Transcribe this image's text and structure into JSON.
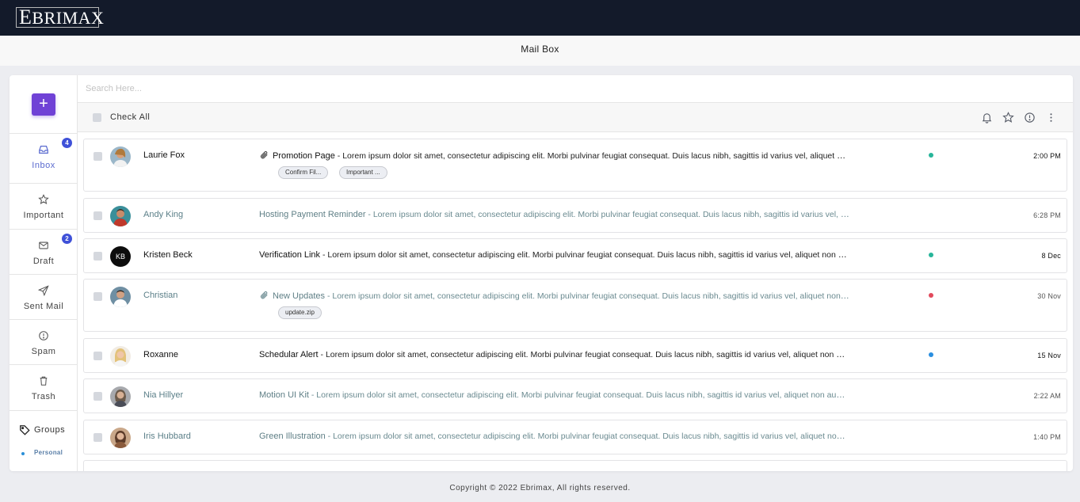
{
  "brand": {
    "logo_initial": "E",
    "logo_rest": "BRIMAX"
  },
  "page": {
    "title": "Mail Box"
  },
  "compose": {
    "label": "+"
  },
  "sidebar": {
    "items": [
      {
        "label": "Inbox",
        "icon": "inbox-icon",
        "badge": "4",
        "active": true
      },
      {
        "label": "Important",
        "icon": "star-icon",
        "badge": null
      },
      {
        "label": "Draft",
        "icon": "mail-icon",
        "badge": "2"
      },
      {
        "label": "Sent Mail",
        "icon": "send-icon",
        "badge": null
      },
      {
        "label": "Spam",
        "icon": "alert-icon",
        "badge": null
      },
      {
        "label": "Trash",
        "icon": "trash-icon",
        "badge": null
      }
    ],
    "groups": {
      "label": "Groups",
      "items": [
        "Personal"
      ]
    }
  },
  "search": {
    "placeholder": "Search Here..."
  },
  "toolbar": {
    "check_all": "Check All"
  },
  "mails": [
    {
      "name": "Laurie Fox",
      "title": "Promotion Page",
      "desc": " - Lorem ipsum dolor sit amet, consectetur adipiscing elit. Morbi pulvinar feugiat consequat. Duis lacus nibh, sagittis id varius vel, aliquet non augue.",
      "time": "2:00 PM",
      "attachments": [
        "Confirm Fil...",
        "Important ..."
      ],
      "status_color": "#27b59a",
      "unread": true
    },
    {
      "name": "Andy King",
      "title": "Hosting Payment Reminder",
      "desc": " - Lorem ipsum dolor sit amet, consectetur adipiscing elit. Morbi pulvinar feugiat consequat. Duis lacus nibh, sagittis id varius vel, aliquet non augue.",
      "time": "6:28 PM",
      "attachments": [],
      "status_color": null,
      "unread": false
    },
    {
      "name": "Kristen Beck",
      "initials": "KB",
      "title": "Verification Link",
      "desc": " - Lorem ipsum dolor sit amet, consectetur adipiscing elit. Morbi pulvinar feugiat consequat. Duis lacus nibh, sagittis id varius vel, aliquet non augue.",
      "time": "8 Dec",
      "attachments": [],
      "status_color": "#27b59a",
      "unread": true
    },
    {
      "name": "Christian",
      "title": "New Updates",
      "desc": " - Lorem ipsum dolor sit amet, consectetur adipiscing elit. Morbi pulvinar feugiat consequat. Duis lacus nibh, sagittis id varius vel, aliquet non augue.",
      "time": "30 Nov",
      "attachments": [
        "update.zip"
      ],
      "status_color": "#e24a5c",
      "unread": false
    },
    {
      "name": "Roxanne",
      "title": "Schedular Alert",
      "desc": " - Lorem ipsum dolor sit amet, consectetur adipiscing elit. Morbi pulvinar feugiat consequat. Duis lacus nibh, sagittis id varius vel, aliquet non augue.",
      "time": "15 Nov",
      "attachments": [],
      "status_color": "#2a8fe0",
      "unread": true
    },
    {
      "name": "Nia Hillyer",
      "title": "Motion UI Kit",
      "desc": " - Lorem ipsum dolor sit amet, consectetur adipiscing elit. Morbi pulvinar feugiat consequat. Duis lacus nibh, sagittis id varius vel, aliquet non augue.",
      "time": "2:22 AM",
      "attachments": [],
      "status_color": null,
      "unread": false
    },
    {
      "name": "Iris Hubbard",
      "title": "Green Illustration",
      "desc": " - Lorem ipsum dolor sit amet, consectetur adipiscing elit. Morbi pulvinar feugiat consequat. Duis lacus nibh, sagittis id varius vel, aliquet non augue.",
      "time": "1:40 PM",
      "attachments": [],
      "status_color": null,
      "unread": false
    }
  ],
  "footer": {
    "text": "Copyright © 2022 Ebrimax, All rights reserved."
  }
}
